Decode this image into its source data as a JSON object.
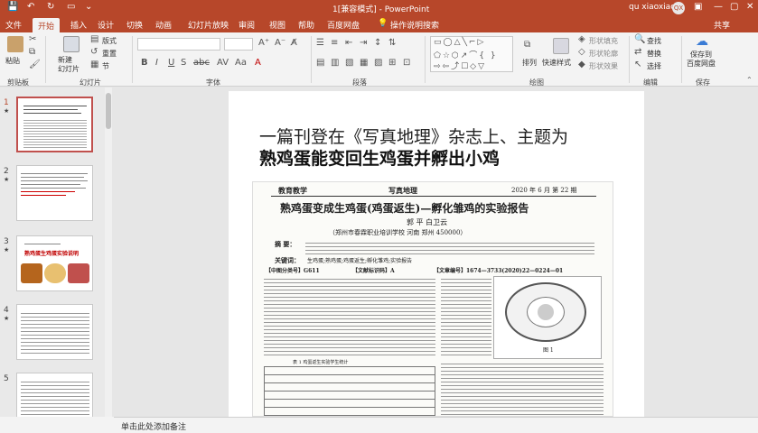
{
  "titlebar": {
    "title": "1[兼容模式] - PowerPoint",
    "user": "qu xiaoxiao",
    "avatar": "QX"
  },
  "tabs": [
    {
      "label": "文件"
    },
    {
      "label": "开始"
    },
    {
      "label": "插入"
    },
    {
      "label": "设计"
    },
    {
      "label": "切换"
    },
    {
      "label": "动画"
    },
    {
      "label": "幻灯片放映"
    },
    {
      "label": "审阅"
    },
    {
      "label": "视图"
    },
    {
      "label": "帮助"
    },
    {
      "label": "百度网盘"
    },
    {
      "label": "操作说明搜索"
    },
    {
      "label": "共享"
    }
  ],
  "ribbon": {
    "paste": "粘贴",
    "new_slide": "新建\n幻灯片",
    "layout": "版式",
    "reset": "重置",
    "section": "节",
    "arrange": "排列",
    "quick_styles": "快速样式",
    "shape_fill": "形状填充",
    "shape_outline": "形状轮廓",
    "shape_effects": "形状效果",
    "find": "查找",
    "replace": "替换",
    "select": "选择",
    "save_to": "保存到\n百度网盘",
    "groups": {
      "clipboard": "剪贴板",
      "slides": "幻灯片",
      "font": "字体",
      "paragraph": "段落",
      "drawing": "绘图",
      "editing": "编辑",
      "save": "保存"
    }
  },
  "slides_panel": {
    "numbers": [
      "1",
      "2",
      "3",
      "4",
      "5"
    ],
    "thumb3_title": "熟鸡蛋生鸡蛋实验说明"
  },
  "slide": {
    "headline_line1": "一篇刊登在《写真地理》杂志上、主题为",
    "headline_line2": "熟鸡蛋能变回生鸡蛋并孵出小鸡",
    "article": {
      "section": "教育教学",
      "journal": "写真地理",
      "issue": "2020 年 6 月   第 22 期",
      "title": "熟鸡蛋变成生鸡蛋(鸡蛋返生)—孵化雏鸡的实验报告",
      "authors": "郭  平   白卫云",
      "affiliation": "（郑州市春霖职业培训学校   河南   郑州   450000）",
      "abstract_label": "摘  要：",
      "keywords_label": "关键词：",
      "keywords": "生鸡蛋;熟鸡蛋;鸡蛋返生;孵化雏鸡;实验报告",
      "clc": "【中图分类号】G611",
      "doc_code": "【文献标识码】A",
      "article_no": "【文章编号】1674—3733(2020)22—0224—01",
      "figure_label": "图 1",
      "table_caption": "表 1   鸡蛋返生实验学生统计"
    }
  },
  "notes": {
    "placeholder": "单击此处添加备注"
  }
}
